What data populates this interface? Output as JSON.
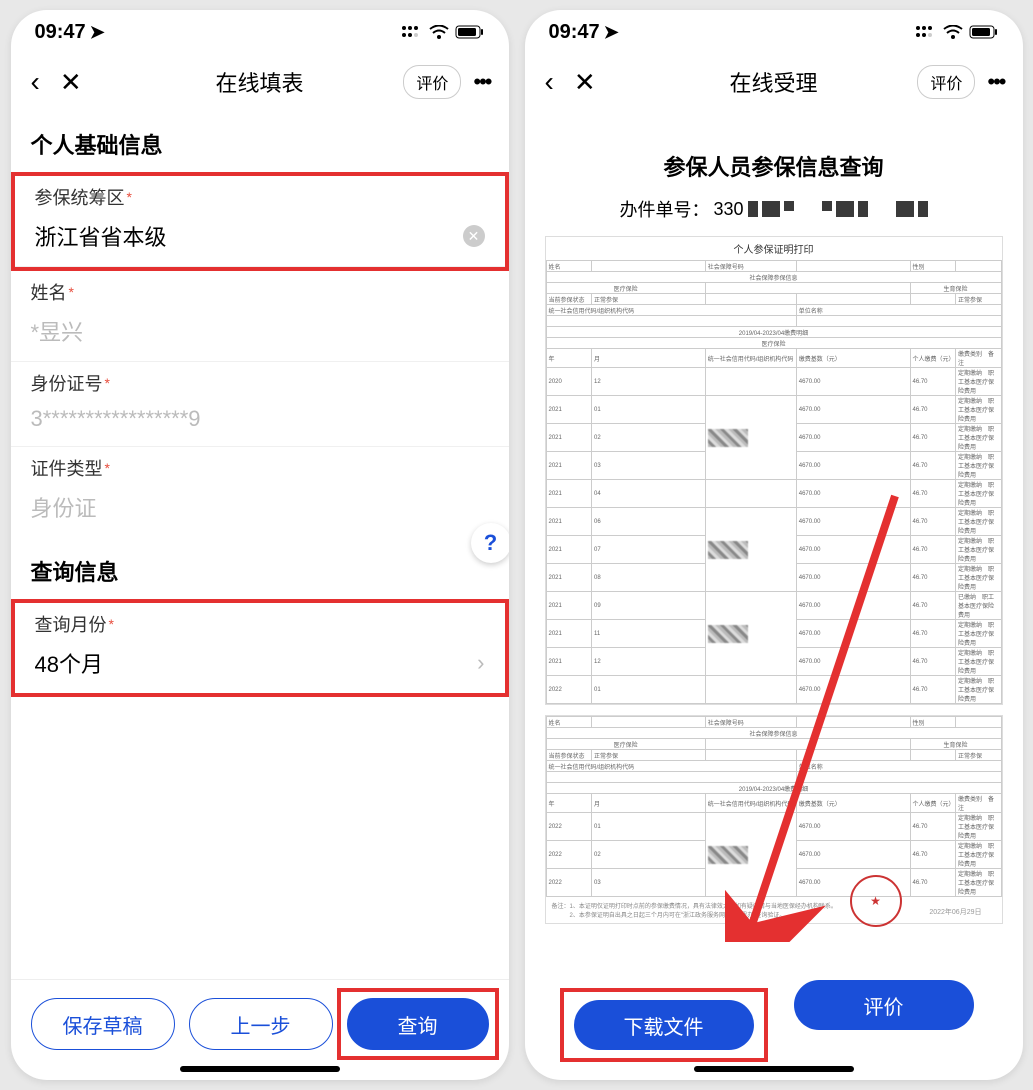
{
  "left": {
    "status": {
      "time": "09:47"
    },
    "nav": {
      "title": "在线填表",
      "rating": "评价"
    },
    "section1_header": "个人基础信息",
    "fields": {
      "region": {
        "label": "参保统筹区",
        "value": "浙江省省本级"
      },
      "name": {
        "label": "姓名",
        "value": "*昱兴"
      },
      "idno": {
        "label": "身份证号",
        "value": "3*****************9"
      },
      "idtype": {
        "label": "证件类型",
        "value": "身份证"
      }
    },
    "section2_header": "查询信息",
    "query_month": {
      "label": "查询月份",
      "value": "48个月"
    },
    "buttons": {
      "save_draft": "保存草稿",
      "prev": "上一步",
      "query": "查询"
    }
  },
  "right": {
    "status": {
      "time": "09:47"
    },
    "nav": {
      "title": "在线受理",
      "rating": "评价"
    },
    "result_title": "参保人员参保信息查询",
    "case_no_label": "办件单号：",
    "case_no_prefix": "330",
    "doc_title": "个人参保证明打印",
    "buttons": {
      "download": "下载文件",
      "rate": "评价"
    }
  }
}
